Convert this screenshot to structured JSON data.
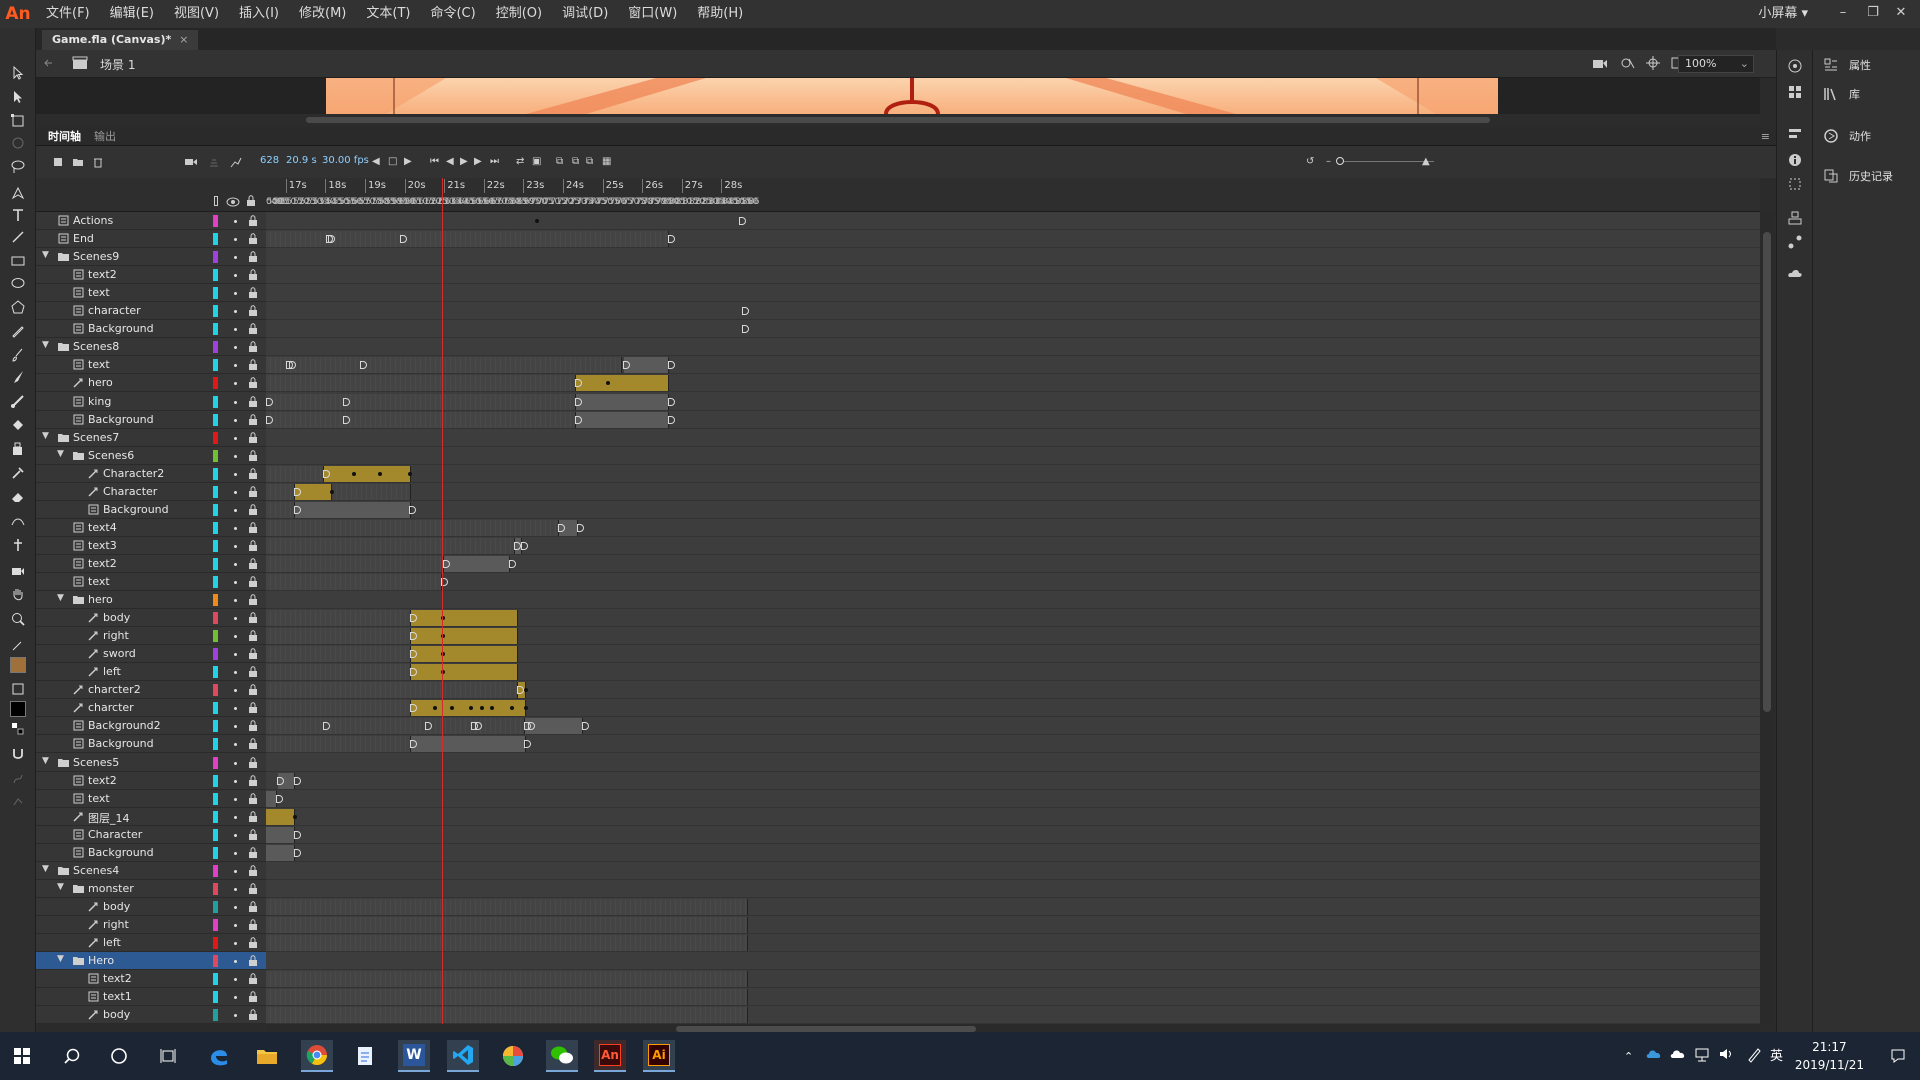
{
  "app": {
    "logo": "An"
  },
  "menu": [
    "文件(F)",
    "编辑(E)",
    "视图(V)",
    "插入(I)",
    "修改(M)",
    "文本(T)",
    "命令(C)",
    "控制(O)",
    "调试(D)",
    "窗口(W)",
    "帮助(H)"
  ],
  "workspace": "小屏幕 ▾",
  "document": {
    "tab": "Game.fla (Canvas)*",
    "close": "×",
    "scene": "场景 1",
    "zoom": "100%"
  },
  "panels": {
    "timeline": "时间轴",
    "output": "输出"
  },
  "controls": {
    "frame": "628",
    "time": "20.9 s",
    "fps": "30.00 fps"
  },
  "ruler": {
    "seconds": [
      "17s",
      "18s",
      "19s",
      "20s",
      "21s",
      "22s",
      "23s",
      "24s",
      "25s",
      "26s",
      "27s",
      "28s"
    ],
    "frame_labels": [
      "0495",
      "500",
      "505",
      "510",
      "515",
      "520",
      "525",
      "530",
      "535",
      "540",
      "545",
      "550",
      "555",
      "560",
      "565",
      "570",
      "575",
      "580",
      "585",
      "590",
      "595",
      "600",
      "605",
      "610",
      "615",
      "620",
      "625",
      "630",
      "635",
      "640",
      "645",
      "650",
      "655",
      "660",
      "665",
      "670",
      "675",
      "680",
      "685",
      "690",
      "695",
      "700",
      "705",
      "710",
      "715",
      "720",
      "725",
      "730",
      "735",
      "740",
      "745",
      "750",
      "755",
      "760",
      "765",
      "770",
      "775",
      "780",
      "785",
      "790",
      "795",
      "800",
      "805",
      "810",
      "815",
      "820",
      "825",
      "830",
      "835",
      "840",
      "845",
      "850",
      "855",
      "860",
      "86"
    ]
  },
  "layers": [
    {
      "name": "Actions",
      "depth": 0,
      "kind": "layer",
      "color": "#e040c8"
    },
    {
      "name": "End",
      "depth": 0,
      "kind": "layer",
      "color": "#22d3e6"
    },
    {
      "name": "Scenes9",
      "depth": 0,
      "kind": "folder",
      "color": "#a040e0"
    },
    {
      "name": "text2",
      "depth": 1,
      "kind": "layer",
      "color": "#22d3e6"
    },
    {
      "name": "text",
      "depth": 1,
      "kind": "layer",
      "color": "#22d3e6"
    },
    {
      "name": "character",
      "depth": 1,
      "kind": "layer",
      "color": "#22d3e6"
    },
    {
      "name": "Background",
      "depth": 1,
      "kind": "layer",
      "color": "#22d3e6"
    },
    {
      "name": "Scenes8",
      "depth": 0,
      "kind": "folder",
      "color": "#a040e0"
    },
    {
      "name": "text",
      "depth": 1,
      "kind": "layer",
      "color": "#22d3e6"
    },
    {
      "name": "hero",
      "depth": 1,
      "kind": "motion",
      "color": "#e01818"
    },
    {
      "name": "king",
      "depth": 1,
      "kind": "layer",
      "color": "#22d3e6"
    },
    {
      "name": "Background",
      "depth": 1,
      "kind": "layer",
      "color": "#22d3e6"
    },
    {
      "name": "Scenes7",
      "depth": 0,
      "kind": "folder",
      "color": "#e01818"
    },
    {
      "name": "Scenes6",
      "depth": 1,
      "kind": "folder",
      "color": "#70c030"
    },
    {
      "name": "Character2",
      "depth": 2,
      "kind": "motion",
      "color": "#22d3e6"
    },
    {
      "name": "Character",
      "depth": 2,
      "kind": "motion",
      "color": "#22d3e6"
    },
    {
      "name": "Background",
      "depth": 2,
      "kind": "layer",
      "color": "#22d3e6"
    },
    {
      "name": "text4",
      "depth": 1,
      "kind": "layer",
      "color": "#22d3e6"
    },
    {
      "name": "text3",
      "depth": 1,
      "kind": "layer",
      "color": "#22d3e6"
    },
    {
      "name": "text2",
      "depth": 1,
      "kind": "layer",
      "color": "#22d3e6"
    },
    {
      "name": "text",
      "depth": 1,
      "kind": "layer",
      "color": "#22d3e6"
    },
    {
      "name": "hero",
      "depth": 1,
      "kind": "folder",
      "color": "#f08a18"
    },
    {
      "name": "body",
      "depth": 2,
      "kind": "motion",
      "color": "#e04860"
    },
    {
      "name": "right",
      "depth": 2,
      "kind": "motion",
      "color": "#70c030"
    },
    {
      "name": "sword",
      "depth": 2,
      "kind": "motion",
      "color": "#a040e0"
    },
    {
      "name": "left",
      "depth": 2,
      "kind": "motion",
      "color": "#22d3e6"
    },
    {
      "name": "charcter2",
      "depth": 1,
      "kind": "motion",
      "color": "#e04860"
    },
    {
      "name": "charcter",
      "depth": 1,
      "kind": "motion",
      "color": "#22d3e6"
    },
    {
      "name": "Background2",
      "depth": 1,
      "kind": "layer",
      "color": "#22d3e6"
    },
    {
      "name": "Background",
      "depth": 1,
      "kind": "layer",
      "color": "#22d3e6"
    },
    {
      "name": "Scenes5",
      "depth": 0,
      "kind": "folder",
      "color": "#e040c8"
    },
    {
      "name": "text2",
      "depth": 1,
      "kind": "layer",
      "color": "#22d3e6"
    },
    {
      "name": "text",
      "depth": 1,
      "kind": "layer",
      "color": "#22d3e6"
    },
    {
      "name": "图层_14",
      "depth": 1,
      "kind": "motion",
      "color": "#22d3e6"
    },
    {
      "name": "Character",
      "depth": 1,
      "kind": "layer",
      "color": "#22d3e6"
    },
    {
      "name": "Background",
      "depth": 1,
      "kind": "layer",
      "color": "#22d3e6"
    },
    {
      "name": "Scenes4",
      "depth": 0,
      "kind": "folder",
      "color": "#e040c8"
    },
    {
      "name": "monster",
      "depth": 1,
      "kind": "folder",
      "color": "#e04860"
    },
    {
      "name": "body",
      "depth": 2,
      "kind": "motion",
      "color": "#22a0a0"
    },
    {
      "name": "right",
      "depth": 2,
      "kind": "motion",
      "color": "#e040c8"
    },
    {
      "name": "left",
      "depth": 2,
      "kind": "motion",
      "color": "#e01818"
    },
    {
      "name": "Hero",
      "depth": 1,
      "kind": "folder",
      "color": "#e04860",
      "selected": true
    },
    {
      "name": "text2",
      "depth": 2,
      "kind": "layer",
      "color": "#22d3e6"
    },
    {
      "name": "text1",
      "depth": 2,
      "kind": "layer",
      "color": "#22d3e6"
    },
    {
      "name": "body",
      "depth": 2,
      "kind": "motion",
      "color": "#22a0a0"
    }
  ],
  "playhead_frame": 628,
  "frames": [
    {
      "spans": [],
      "keys": [
        [
          "d",
          700
        ],
        [
          "k",
          854
        ]
      ]
    },
    {
      "spans": [
        [
          "e",
          495,
          800
        ]
      ],
      "keys": [
        [
          "k",
          541
        ],
        [
          "k",
          543
        ],
        [
          "k",
          597
        ],
        [
          "k",
          800
        ]
      ]
    },
    {
      "spans": [],
      "keys": []
    },
    {
      "spans": [],
      "keys": []
    },
    {
      "spans": [],
      "keys": []
    },
    {
      "spans": [],
      "keys": [
        [
          "k",
          856
        ]
      ]
    },
    {
      "spans": [],
      "keys": [
        [
          "k",
          856
        ]
      ]
    },
    {
      "spans": [],
      "keys": []
    },
    {
      "spans": [
        [
          "e",
          495,
          765
        ],
        [
          "s",
          766,
          800
        ]
      ],
      "keys": [
        [
          "k",
          511
        ],
        [
          "k",
          513
        ],
        [
          "k",
          567
        ],
        [
          "k",
          766
        ],
        [
          "k",
          800
        ]
      ]
    },
    {
      "spans": [
        [
          "e",
          495,
          730
        ],
        [
          "t",
          730,
          800
        ]
      ],
      "keys": [
        [
          "k",
          730
        ],
        [
          "d",
          754
        ]
      ]
    },
    {
      "spans": [
        [
          "e",
          495,
          730
        ],
        [
          "s",
          730,
          800
        ]
      ],
      "keys": [
        [
          "k",
          496
        ],
        [
          "k",
          554
        ],
        [
          "k",
          730
        ],
        [
          "k",
          800
        ]
      ]
    },
    {
      "spans": [
        [
          "e",
          495,
          730
        ],
        [
          "s",
          730,
          800
        ]
      ],
      "keys": [
        [
          "k",
          496
        ],
        [
          "k",
          554
        ],
        [
          "k",
          730
        ],
        [
          "k",
          800
        ]
      ]
    },
    {
      "spans": [],
      "keys": []
    },
    {
      "spans": [],
      "keys": []
    },
    {
      "spans": [
        [
          "e",
          495,
          539
        ],
        [
          "t",
          539,
          605
        ]
      ],
      "keys": [
        [
          "k",
          539
        ],
        [
          "d",
          562
        ],
        [
          "d",
          581
        ],
        [
          "d",
          604
        ]
      ]
    },
    {
      "spans": [
        [
          "e",
          495,
          517
        ],
        [
          "t",
          517,
          545
        ],
        [
          "e",
          545,
          605
        ]
      ],
      "keys": [
        [
          "k",
          517
        ],
        [
          "d",
          545
        ]
      ]
    },
    {
      "spans": [
        [
          "e",
          495,
          517
        ],
        [
          "s",
          517,
          605
        ]
      ],
      "keys": [
        [
          "k",
          517
        ],
        [
          "k",
          604
        ]
      ]
    },
    {
      "spans": [
        [
          "e",
          495,
          717
        ],
        [
          "s",
          717,
          731
        ]
      ],
      "keys": [
        [
          "k",
          717
        ],
        [
          "k",
          731
        ]
      ]
    },
    {
      "spans": [
        [
          "e",
          495,
          684
        ],
        [
          "s",
          684,
          689
        ]
      ],
      "keys": [
        [
          "k",
          684
        ],
        [
          "k",
          689
        ]
      ]
    },
    {
      "spans": [
        [
          "e",
          495,
          630
        ],
        [
          "s",
          630,
          680
        ]
      ],
      "keys": [
        [
          "k",
          630
        ],
        [
          "k",
          680
        ]
      ]
    },
    {
      "spans": [
        [
          "e",
          495,
          628
        ]
      ],
      "keys": [
        [
          "k",
          628
        ]
      ]
    },
    {
      "spans": [],
      "keys": []
    },
    {
      "spans": [
        [
          "e",
          495,
          605
        ],
        [
          "t",
          605,
          686
        ]
      ],
      "keys": [
        [
          "k",
          605
        ],
        [
          "d",
          629
        ]
      ]
    },
    {
      "spans": [
        [
          "e",
          495,
          605
        ],
        [
          "t",
          605,
          686
        ]
      ],
      "keys": [
        [
          "k",
          605
        ],
        [
          "d",
          629
        ]
      ]
    },
    {
      "spans": [
        [
          "e",
          495,
          605
        ],
        [
          "t",
          605,
          686
        ]
      ],
      "keys": [
        [
          "k",
          605
        ],
        [
          "d",
          629
        ]
      ]
    },
    {
      "spans": [
        [
          "e",
          495,
          605
        ],
        [
          "t",
          605,
          686
        ]
      ],
      "keys": [
        [
          "k",
          605
        ],
        [
          "d",
          629
        ]
      ]
    },
    {
      "spans": [
        [
          "e",
          495,
          686
        ],
        [
          "t",
          686,
          692
        ]
      ],
      "keys": [
        [
          "k",
          686
        ],
        [
          "d",
          692
        ]
      ]
    },
    {
      "spans": [
        [
          "e",
          495,
          605
        ],
        [
          "t",
          605,
          692
        ]
      ],
      "keys": [
        [
          "k",
          605
        ],
        [
          "d",
          623
        ],
        [
          "d",
          636
        ],
        [
          "d",
          650
        ],
        [
          "d",
          659
        ],
        [
          "d",
          666
        ],
        [
          "d",
          681
        ],
        [
          "d",
          692
        ]
      ]
    },
    {
      "spans": [
        [
          "e",
          495,
          691
        ],
        [
          "s",
          691,
          735
        ]
      ],
      "keys": [
        [
          "k",
          539
        ],
        [
          "k",
          616
        ],
        [
          "k",
          651
        ],
        [
          "k",
          654
        ],
        [
          "k",
          691
        ],
        [
          "k",
          694
        ],
        [
          "k",
          735
        ]
      ]
    },
    {
      "spans": [
        [
          "e",
          495,
          605
        ],
        [
          "s",
          605,
          692
        ]
      ],
      "keys": [
        [
          "k",
          605
        ],
        [
          "k",
          691
        ]
      ]
    },
    {
      "spans": [],
      "keys": []
    },
    {
      "spans": [
        [
          "s",
          504,
          517
        ]
      ],
      "keys": [
        [
          "k",
          504
        ],
        [
          "k",
          517
        ]
      ]
    },
    {
      "spans": [
        [
          "s",
          495,
          503
        ]
      ],
      "keys": [
        [
          "k",
          503
        ]
      ]
    },
    {
      "spans": [
        [
          "t",
          495,
          517
        ]
      ],
      "keys": [
        [
          "d",
          517
        ]
      ]
    },
    {
      "spans": [
        [
          "s",
          495,
          517
        ]
      ],
      "keys": [
        [
          "k",
          517
        ]
      ]
    },
    {
      "spans": [
        [
          "s",
          495,
          517
        ]
      ],
      "keys": [
        [
          "k",
          517
        ]
      ]
    },
    {
      "spans": [],
      "keys": []
    },
    {
      "spans": [],
      "keys": []
    },
    {
      "spans": [
        [
          "e",
          495,
          860
        ]
      ],
      "keys": []
    },
    {
      "spans": [
        [
          "e",
          495,
          860
        ]
      ],
      "keys": []
    },
    {
      "spans": [
        [
          "e",
          495,
          860
        ]
      ],
      "keys": []
    },
    {
      "spans": [],
      "keys": []
    },
    {
      "spans": [
        [
          "e",
          495,
          860
        ]
      ],
      "keys": []
    },
    {
      "spans": [
        [
          "e",
          495,
          860
        ]
      ],
      "keys": []
    },
    {
      "spans": [
        [
          "e",
          495,
          860
        ]
      ],
      "keys": []
    }
  ],
  "right_panel": {
    "items": [
      {
        "label": "属性",
        "icon": "properties-icon"
      },
      {
        "label": "库",
        "icon": "library-icon"
      },
      {
        "label": "动作",
        "icon": "actions-icon"
      },
      {
        "label": "历史记录",
        "icon": "history-icon"
      }
    ]
  },
  "taskbar": {
    "apps": [
      "start-icon",
      "search-icon",
      "cortana-icon",
      "task-view-icon",
      "edge-icon",
      "explorer-icon",
      "chrome-icon",
      "notepad-icon",
      "word-icon",
      "vscode-icon",
      "photos-icon",
      "wechat-icon",
      "animate-icon",
      "illustrator-icon"
    ],
    "animate_label": "An",
    "illustrator_label": "Ai",
    "word_label": "W",
    "ime": "英",
    "time": "21:17",
    "date": "2019/11/21"
  }
}
